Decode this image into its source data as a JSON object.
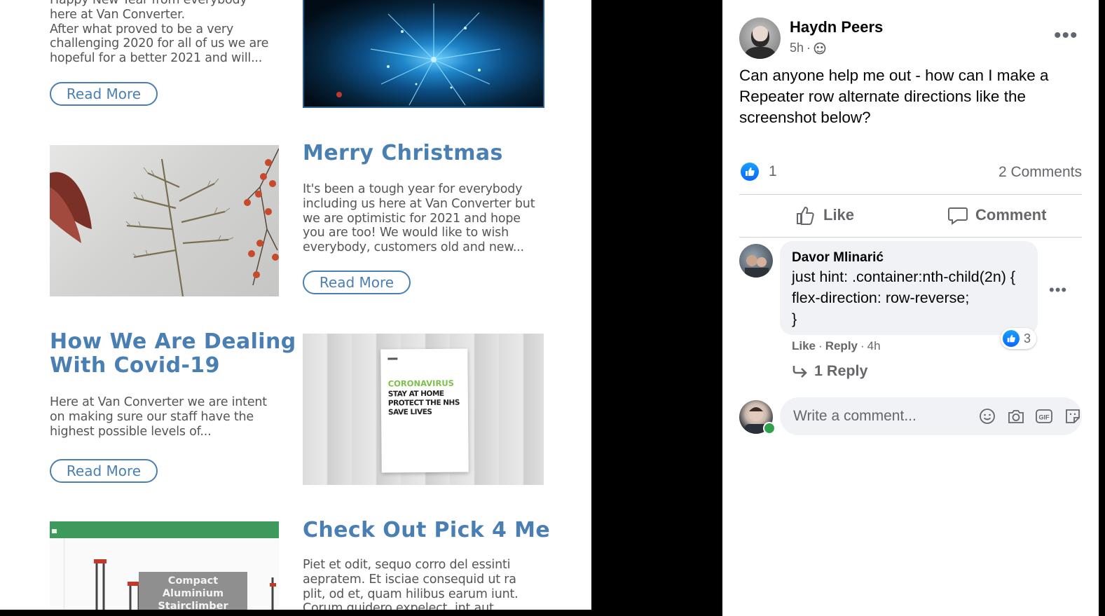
{
  "newsletter": {
    "items": [
      {
        "text_lines": [
          "Happy New Year from everybody",
          "here at Van Converter.",
          "After what proved to be a very",
          "challenging 2020 for all of us we are",
          "hopeful for a better 2021 and will..."
        ],
        "button": "Read More"
      },
      {
        "title": "Merry Christmas",
        "text_lines": [
          "It's been a tough year for everybody",
          "including us here at Van Converter but",
          "we are optimistic for 2021 and hope",
          "you are too!  We would like to wish",
          "everybody, customers old and new..."
        ],
        "button": "Read More"
      },
      {
        "title_lines": [
          "How We Are Dealing",
          "With Covid-19"
        ],
        "text_lines": [
          "Here at Van Converter we are intent",
          "on making sure our staff have the",
          "highest possible levels of..."
        ],
        "button": "Read More"
      },
      {
        "title": "Check Out Pick 4 Me",
        "text_lines": [
          "Piet et odit, sequo corro del essinti",
          "aepratem. Et isciae consequid ut ra",
          "plit, od et, quam hilibus earum iunt.",
          "Corum quidero expelect, int aut"
        ]
      }
    ],
    "covid_image": {
      "headline": "CORONAVIRUS",
      "lines": [
        "STAY AT HOME",
        "PROTECT THE NHS",
        "SAVE LIVES"
      ]
    },
    "product_image": {
      "label_lines": [
        "Compact",
        "Aluminium",
        "Stairclimber"
      ]
    }
  },
  "post": {
    "author": "Haydn Peers",
    "time": "5h",
    "privacy_icon": "globe-icon",
    "text": "Can anyone help me out - how can I make a Repeater row alternate directions like the screenshot below?",
    "reaction_count": "1",
    "comments_count": "2 Comments",
    "actions": {
      "like": "Like",
      "comment": "Comment"
    }
  },
  "comment": {
    "author": "Davor Mlinarić",
    "text": "just hint: .container:nth-child(2n) {\nflex-direction: row-reverse;\n}",
    "like": "Like",
    "reply": "Reply",
    "time": "4h",
    "reaction_count": "3",
    "replies_label": "1 Reply"
  },
  "composer": {
    "placeholder": "Write a comment...",
    "icons": [
      "emoji-icon",
      "camera-icon",
      "gif-icon",
      "sticker-icon"
    ]
  },
  "colors": {
    "newsletter_blue": "#4a7fb3",
    "facebook_blue": "#0866ff",
    "muted": "#65676b"
  }
}
